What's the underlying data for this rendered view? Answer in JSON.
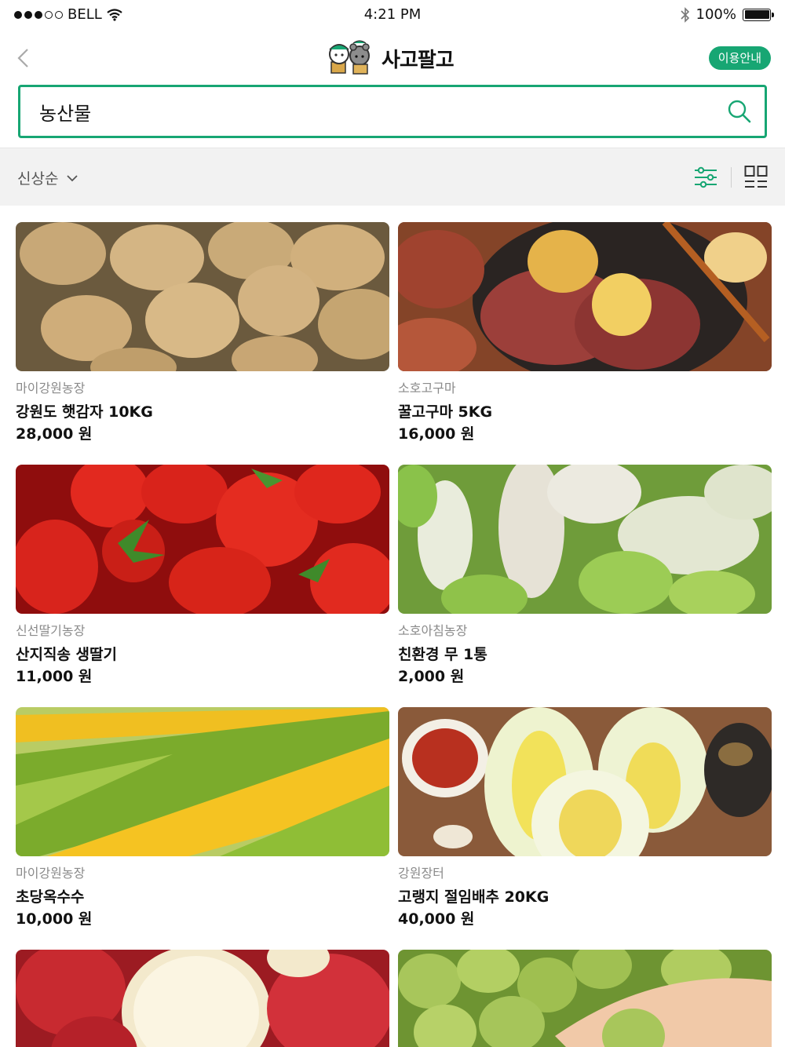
{
  "status_bar": {
    "carrier": "BELL",
    "time": "4:21 PM",
    "battery": "100%"
  },
  "nav": {
    "logo_text": "사고팔고",
    "info_label": "이용안내"
  },
  "search": {
    "value": "농산물"
  },
  "filter": {
    "sort_label": "신상순"
  },
  "products": [
    {
      "seller": "마이강원농장",
      "name": "강원도 햇감자 10KG",
      "price": "28,000 원",
      "image": "potatoes"
    },
    {
      "seller": "소호고구마",
      "name": "꿀고구마 5KG",
      "price": "16,000 원",
      "image": "sweet-potatoes"
    },
    {
      "seller": "신선딸기농장",
      "name": "산지직송 생딸기",
      "price": "11,000 원",
      "image": "strawberries"
    },
    {
      "seller": "소호아침농장",
      "name": "친환경 무 1통",
      "price": "2,000 원",
      "image": "radishes"
    },
    {
      "seller": "마이강원농장",
      "name": "초당옥수수",
      "price": "10,000 원",
      "image": "corn"
    },
    {
      "seller": "강원장터",
      "name": "고랭지 절임배추 20KG",
      "price": "40,000 원",
      "image": "napa-cabbage"
    },
    {
      "image": "apples"
    },
    {
      "image": "green-plums"
    }
  ],
  "colors": {
    "brand": "#17a673",
    "filter_bg": "#f2f2f2",
    "seller_text": "#8a8a8a"
  }
}
